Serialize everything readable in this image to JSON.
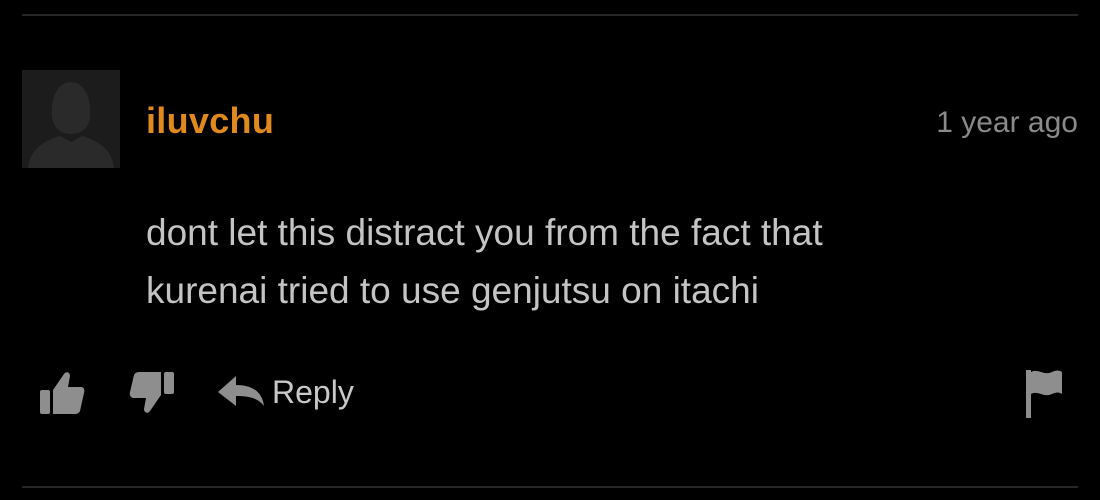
{
  "comment": {
    "username": "iluvchu",
    "timestamp": "1 year ago",
    "text_lines": [
      "dont let this distract you from the fact that",
      "kurenai tried to use genjutsu on itachi"
    ],
    "avatar": "default-silhouette-avatar"
  },
  "actions": {
    "like_icon": "thumbs-up-icon",
    "dislike_icon": "thumbs-down-icon",
    "reply_icon": "reply-arrow-icon",
    "reply_label": "Reply",
    "flag_icon": "flag-icon"
  },
  "colors": {
    "background": "#000000",
    "username": "#e08a1e",
    "text": "#c4c4c4",
    "icons": "#8e8e8e",
    "timestamp": "#8a8a8a"
  }
}
